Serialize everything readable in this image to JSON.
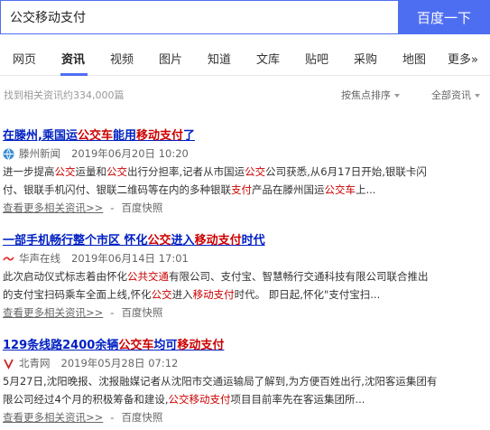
{
  "search": {
    "query": "公交移动支付",
    "button": "百度一下"
  },
  "tabs": [
    "网页",
    "资讯",
    "视频",
    "图片",
    "知道",
    "文库",
    "贴吧",
    "采购",
    "地图",
    "更多»"
  ],
  "result_count": "找到相关资讯约334,000篇",
  "sort": {
    "focus": "按焦点排序",
    "all": "全部资讯"
  },
  "results": [
    {
      "title": [
        {
          "t": "在滕州,乘国运",
          "hl": false
        },
        {
          "t": "公交车",
          "hl": true
        },
        {
          "t": "能用",
          "hl": false
        },
        {
          "t": "移动支付",
          "hl": true
        },
        {
          "t": "了",
          "hl": false
        }
      ],
      "source": "滕州新闻",
      "date": "2019年06月20日 10:20",
      "abstract_1": [
        {
          "t": "进一步提高",
          "hl": false
        },
        {
          "t": "公交",
          "hl": true
        },
        {
          "t": "运量和",
          "hl": false
        },
        {
          "t": "公交",
          "hl": true
        },
        {
          "t": "出行分担率,记者从市国运",
          "hl": false
        },
        {
          "t": "公交",
          "hl": true
        },
        {
          "t": "公司获悉,从6月17日开始,银联卡闪",
          "hl": false
        }
      ],
      "abstract_2": [
        {
          "t": "付、银联手机闪付、银联二维码等在内的多种银联",
          "hl": false
        },
        {
          "t": "支付",
          "hl": true
        },
        {
          "t": "产品在滕州国运",
          "hl": false
        },
        {
          "t": "公交车",
          "hl": true
        },
        {
          "t": "上...",
          "hl": false
        }
      ],
      "more": "查看更多相关资讯>>",
      "cache": "百度快照"
    },
    {
      "title": [
        {
          "t": "一部手机畅行整个市区 怀化",
          "hl": false
        },
        {
          "t": "公交",
          "hl": true
        },
        {
          "t": "进入",
          "hl": false
        },
        {
          "t": "移动支付",
          "hl": true
        },
        {
          "t": "时代",
          "hl": false
        }
      ],
      "source": "华声在线",
      "date": "2019年06月14日 17:01",
      "abstract_1": [
        {
          "t": "此次启动仪式标志着由怀化",
          "hl": false
        },
        {
          "t": "公共交通",
          "hl": true
        },
        {
          "t": "有限公司、支付宝、智慧畅行交通科技有限公司联合推出",
          "hl": false
        }
      ],
      "abstract_2": [
        {
          "t": "的支付宝扫码乘车全面上线,怀化",
          "hl": false
        },
        {
          "t": "公交",
          "hl": true
        },
        {
          "t": "进入",
          "hl": false
        },
        {
          "t": "移动支付",
          "hl": true
        },
        {
          "t": "时代。 即日起,怀化\"支付宝扫...",
          "hl": false
        }
      ],
      "more": "查看更多相关资讯>>",
      "cache": "百度快照"
    },
    {
      "title": [
        {
          "t": "129条线路2400余辆",
          "hl": false
        },
        {
          "t": "公交车",
          "hl": true
        },
        {
          "t": "均可",
          "hl": false
        },
        {
          "t": "移动支付",
          "hl": true
        }
      ],
      "source": "北青网",
      "date": "2019年05月28日 07:12",
      "abstract_1": [
        {
          "t": "5月27日,沈阳晚报、沈报融媒记者从沈阳市交通运输局了解到,为方便百姓出行,沈阳客运集团有",
          "hl": false
        }
      ],
      "abstract_2": [
        {
          "t": "限公司经过4个月的积极筹备和建设,",
          "hl": false
        },
        {
          "t": "公交移动支付",
          "hl": true
        },
        {
          "t": "项目目前率先在客运集团所...",
          "hl": false
        }
      ],
      "more": "查看更多相关资讯>>",
      "cache": "百度快照"
    }
  ],
  "icons": [
    "globe-icon",
    "huasheng-logo-icon",
    "beiqing-logo-icon"
  ],
  "colors": {
    "accent": "#4e6ef2",
    "link": "#0020c2",
    "highlight": "#cc0000"
  }
}
